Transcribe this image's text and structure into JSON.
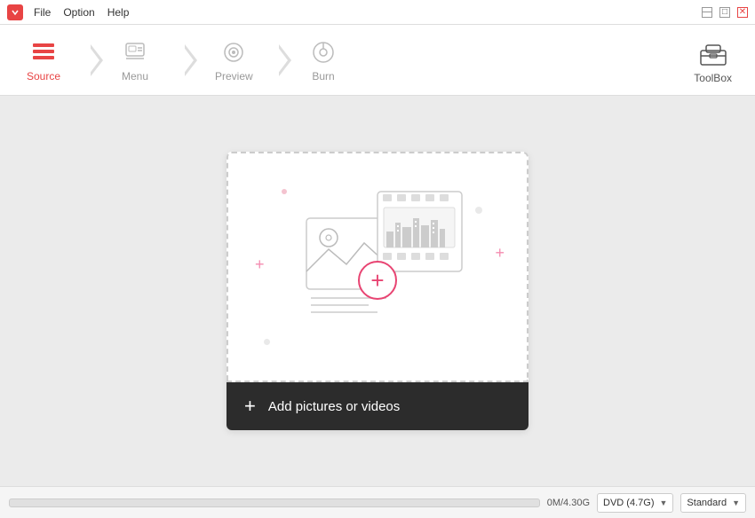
{
  "titlebar": {
    "menu_items": [
      "File",
      "Option",
      "Help"
    ],
    "controls": [
      "_",
      "□",
      "×"
    ]
  },
  "nav": {
    "steps": [
      {
        "id": "source",
        "label": "Source",
        "active": true
      },
      {
        "id": "menu",
        "label": "Menu",
        "active": false
      },
      {
        "id": "preview",
        "label": "Preview",
        "active": false
      },
      {
        "id": "burn",
        "label": "Burn",
        "active": false
      }
    ],
    "toolbox_label": "ToolBox"
  },
  "dropzone": {
    "add_label": "Add pictures or videos",
    "add_button_plus": "+"
  },
  "statusbar": {
    "storage_used": "0M/4.30G",
    "disc_type": "DVD (4.7G)",
    "quality": "Standard"
  }
}
